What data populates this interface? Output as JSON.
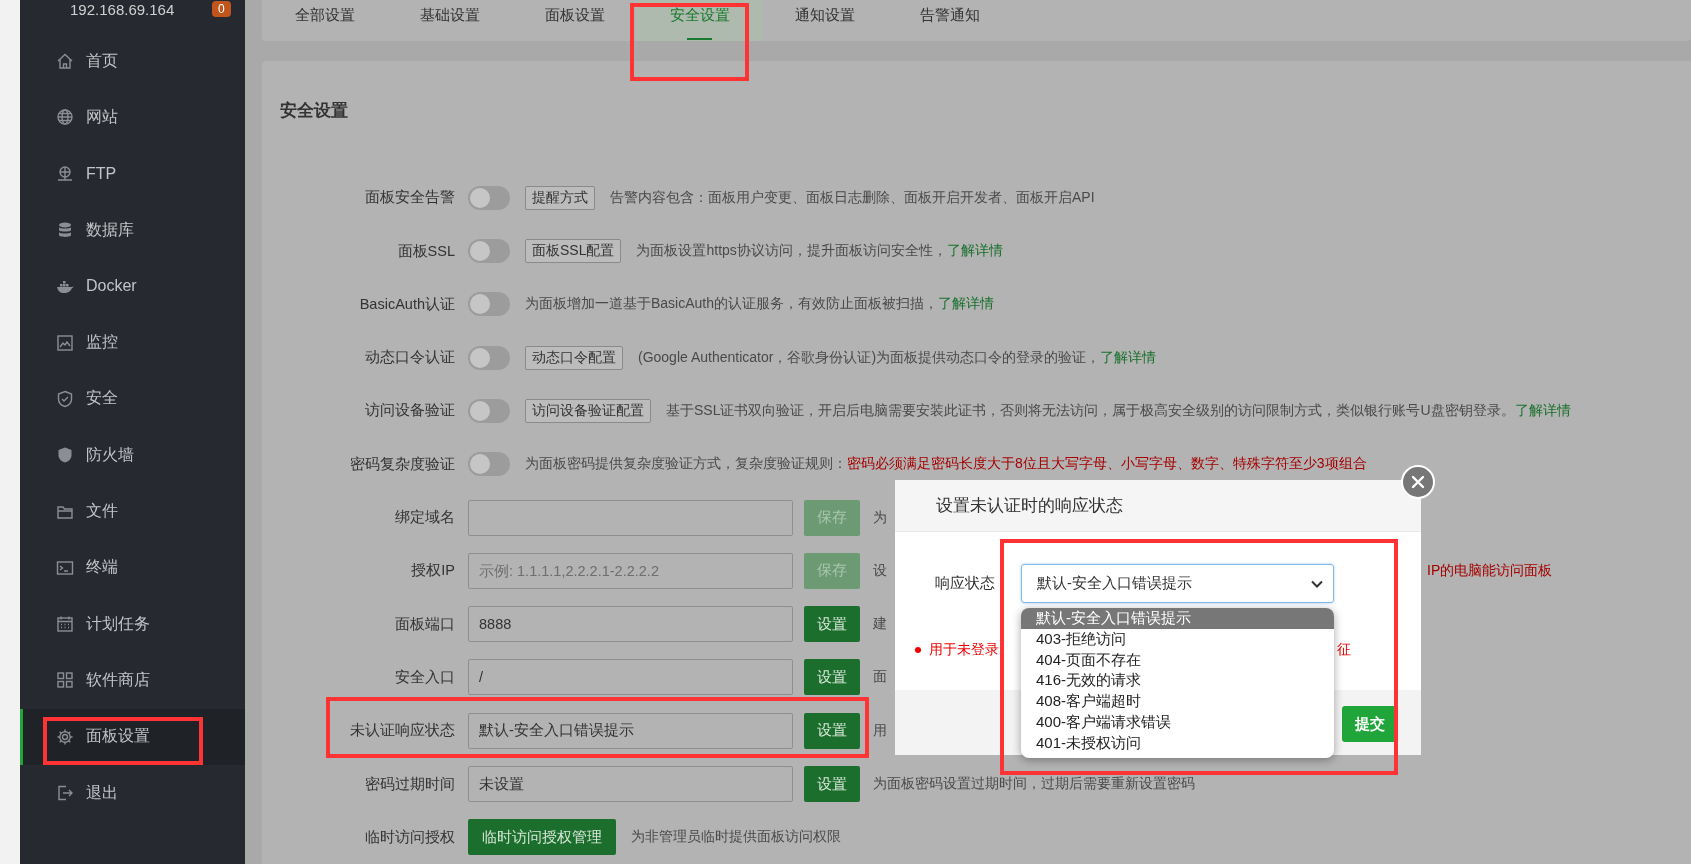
{
  "sidebar": {
    "host": "192.168.69.164",
    "badge": "0",
    "items": [
      {
        "label": "首页",
        "selected": false,
        "highlighted": false
      },
      {
        "label": "网站",
        "selected": false,
        "highlighted": false
      },
      {
        "label": "FTP",
        "selected": false,
        "highlighted": false
      },
      {
        "label": "数据库",
        "selected": false,
        "highlighted": false
      },
      {
        "label": "Docker",
        "selected": false,
        "highlighted": false
      },
      {
        "label": "监控",
        "selected": false,
        "highlighted": false
      },
      {
        "label": "安全",
        "selected": false,
        "highlighted": false
      },
      {
        "label": "防火墙",
        "selected": false,
        "highlighted": false
      },
      {
        "label": "文件",
        "selected": false,
        "highlighted": false
      },
      {
        "label": "终端",
        "selected": false,
        "highlighted": false
      },
      {
        "label": "计划任务",
        "selected": false,
        "highlighted": false
      },
      {
        "label": "软件商店",
        "selected": false,
        "highlighted": false
      },
      {
        "label": "面板设置",
        "selected": true,
        "highlighted": true
      },
      {
        "label": "退出",
        "selected": false,
        "highlighted": false
      }
    ]
  },
  "tabs": [
    {
      "label": "全部设置",
      "selected": false,
      "highlighted": false
    },
    {
      "label": "基础设置",
      "selected": false,
      "highlighted": false
    },
    {
      "label": "面板设置",
      "selected": false,
      "highlighted": false
    },
    {
      "label": "安全设置",
      "selected": true,
      "highlighted": true
    },
    {
      "label": "通知设置",
      "selected": false,
      "highlighted": false
    },
    {
      "label": "告警通知",
      "selected": false,
      "highlighted": false
    }
  ],
  "section_title": "安全设置",
  "rows": [
    {
      "kind": "toggle",
      "label": "面板安全告警",
      "on": false,
      "button": "提醒方式",
      "description": "告警内容包含：面板用户变更、面板日志删除、面板开启开发者、面板开启API",
      "highlighted": false
    },
    {
      "kind": "toggle",
      "label": "面板SSL",
      "on": false,
      "button": "面板SSL配置",
      "description": "为面板设置https协议访问，提升面板访问安全性，",
      "link": "了解详情",
      "highlighted": false
    },
    {
      "kind": "toggle",
      "label": "BasicAuth认证",
      "on": false,
      "description": "为面板增加一道基于BasicAuth的认证服务，有效防止面板被扫描，",
      "link": "了解详情",
      "highlighted": false
    },
    {
      "kind": "toggle",
      "label": "动态口令认证",
      "on": false,
      "button": "动态口令配置",
      "description": "(Google Authenticator，谷歌身份认证)为面板提供动态口令的登录的验证，",
      "link": "了解详情",
      "highlighted": false
    },
    {
      "kind": "toggle",
      "label": "访问设备验证",
      "on": false,
      "button": "访问设备验证配置",
      "description": "基于SSL证书双向验证，开启后电脑需要安装此证书，否则将无法访问，属于极高安全级别的访问限制方式，类似银行账号U盘密钥登录。",
      "link": "了解详情",
      "highlighted": false
    },
    {
      "kind": "toggle",
      "label": "密码复杂度验证",
      "on": false,
      "description": "为面板密码提供复杂度验证方式，复杂度验证规则：",
      "warning": "密码必须满足密码长度大于8位且大写字母、小写字母、数字、特殊字符至少3项组合",
      "highlighted": false
    },
    {
      "kind": "input",
      "label": "绑定域名",
      "button": "保存",
      "disabled": true,
      "description": "为",
      "highlighted": false
    },
    {
      "kind": "input",
      "label": "授权IP",
      "placeholder": "示例: 1.1.1.1,2.2.2.1-2.2.2.2",
      "button": "保存",
      "disabled": true,
      "description": "设",
      "tail": "IP的电脑能访问面板",
      "highlighted": false
    },
    {
      "kind": "input",
      "label": "面板端口",
      "value": "8888",
      "button": "设置",
      "disabled": false,
      "description": "建",
      "highlighted": false
    },
    {
      "kind": "input",
      "label": "安全入口",
      "value": "/",
      "button": "设置",
      "disabled": false,
      "description": "面",
      "highlighted": false
    },
    {
      "kind": "input",
      "label": "未认证响应状态",
      "value": "默认-安全入口错误提示",
      "button": "设置",
      "disabled": false,
      "description": "用",
      "highlighted": true
    },
    {
      "kind": "input",
      "label": "密码过期时间",
      "value": "未设置",
      "button": "设置",
      "disabled": false,
      "description": "为面板密码设置过期时间，过期后需要重新设置密码",
      "highlighted": false
    },
    {
      "kind": "action",
      "label": "临时访问授权",
      "button": "临时访问授权管理",
      "description": "为非管理员临时提供面板访问权限",
      "highlighted": false
    }
  ],
  "modal": {
    "title": "设置未认证时的响应状态",
    "field": {
      "label": "响应状态",
      "value": "默认-安全入口错误提示",
      "expanded": true,
      "highlighted": true,
      "options": [
        {
          "label": "默认-安全入口错误提示",
          "selected": true
        },
        {
          "label": "403-拒绝访问",
          "selected": false
        },
        {
          "label": "404-页面不存在",
          "selected": false
        },
        {
          "label": "416-无效的请求",
          "selected": false
        },
        {
          "label": "408-客户端超时",
          "selected": false
        },
        {
          "label": "400-客户端请求错误",
          "selected": false
        },
        {
          "label": "401-未授权访问",
          "selected": false
        }
      ]
    },
    "note": "用于未登录",
    "note_tail": "征",
    "submit": "提交"
  }
}
